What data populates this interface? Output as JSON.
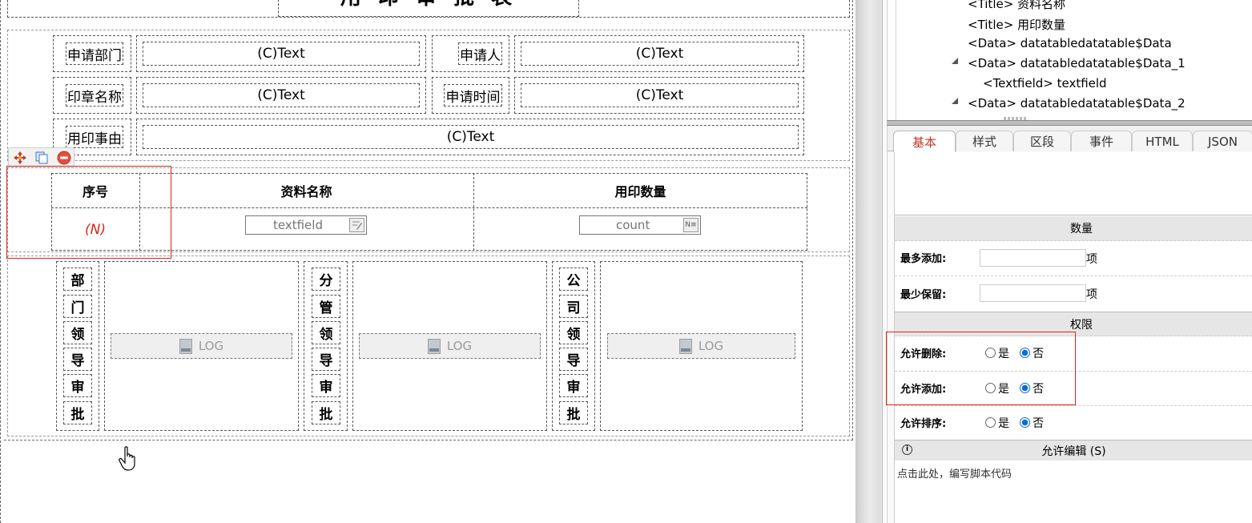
{
  "form": {
    "title_partial": "用 印 审 批 表",
    "rows": [
      {
        "label": "申请部门",
        "value": "(C)Text",
        "label2": "申请人",
        "value2": "(C)Text"
      },
      {
        "label": "印章名称",
        "value": "(C)Text",
        "label2": "申请时间",
        "value2": "(C)Text"
      },
      {
        "label": "用印事由",
        "value": "(C)Text"
      }
    ],
    "table": {
      "headers": [
        "序号",
        "资料名称",
        "用印数量"
      ],
      "row": {
        "index": "(N)",
        "name_placeholder": "textfield",
        "count_placeholder": "count"
      }
    },
    "approvals": [
      {
        "chars": [
          "部",
          "门",
          "领",
          "导",
          "审",
          "批"
        ],
        "log_label": "LOG"
      },
      {
        "chars": [
          "分",
          "管",
          "领",
          "导",
          "审",
          "批"
        ],
        "log_label": "LOG"
      },
      {
        "chars": [
          "公",
          "司",
          "领",
          "导",
          "审",
          "批"
        ],
        "log_label": "LOG"
      }
    ]
  },
  "tree": {
    "items": [
      {
        "text": "<Title> 资料名称",
        "indent": 0,
        "expander": false
      },
      {
        "text": "<Title> 用印数量",
        "indent": 0,
        "expander": false
      },
      {
        "text": "<Data> datatabledatatable$Data",
        "indent": 0,
        "expander": false
      },
      {
        "text": "<Data> datatabledatatable$Data_1",
        "indent": 0,
        "expander": true
      },
      {
        "text": "<Textfield> textfield",
        "indent": 1,
        "expander": false
      },
      {
        "text": "<Data> datatabledatatable$Data_2",
        "indent": 0,
        "expander": true
      }
    ]
  },
  "props": {
    "tabs": [
      "基本",
      "样式",
      "区段",
      "事件",
      "HTML",
      "JSON"
    ],
    "active_tab": "基本",
    "section_quantity": "数量",
    "max_add_label": "最多添加:",
    "max_add_unit": "项",
    "min_keep_label": "最少保留:",
    "min_keep_unit": "项",
    "section_permission": "权限",
    "allow_delete_label": "允许删除:",
    "allow_add_label": "允许添加:",
    "allow_sort_label": "允许排序:",
    "yes": "是",
    "no": "否",
    "allow_edit_label": "允许编辑 (S)",
    "script_hint": "点击此处，编写脚本代码"
  },
  "colors": {
    "accent_red": "#d9261c",
    "radio_blue": "#0a6cd6",
    "tab_active": "#c0392b"
  }
}
